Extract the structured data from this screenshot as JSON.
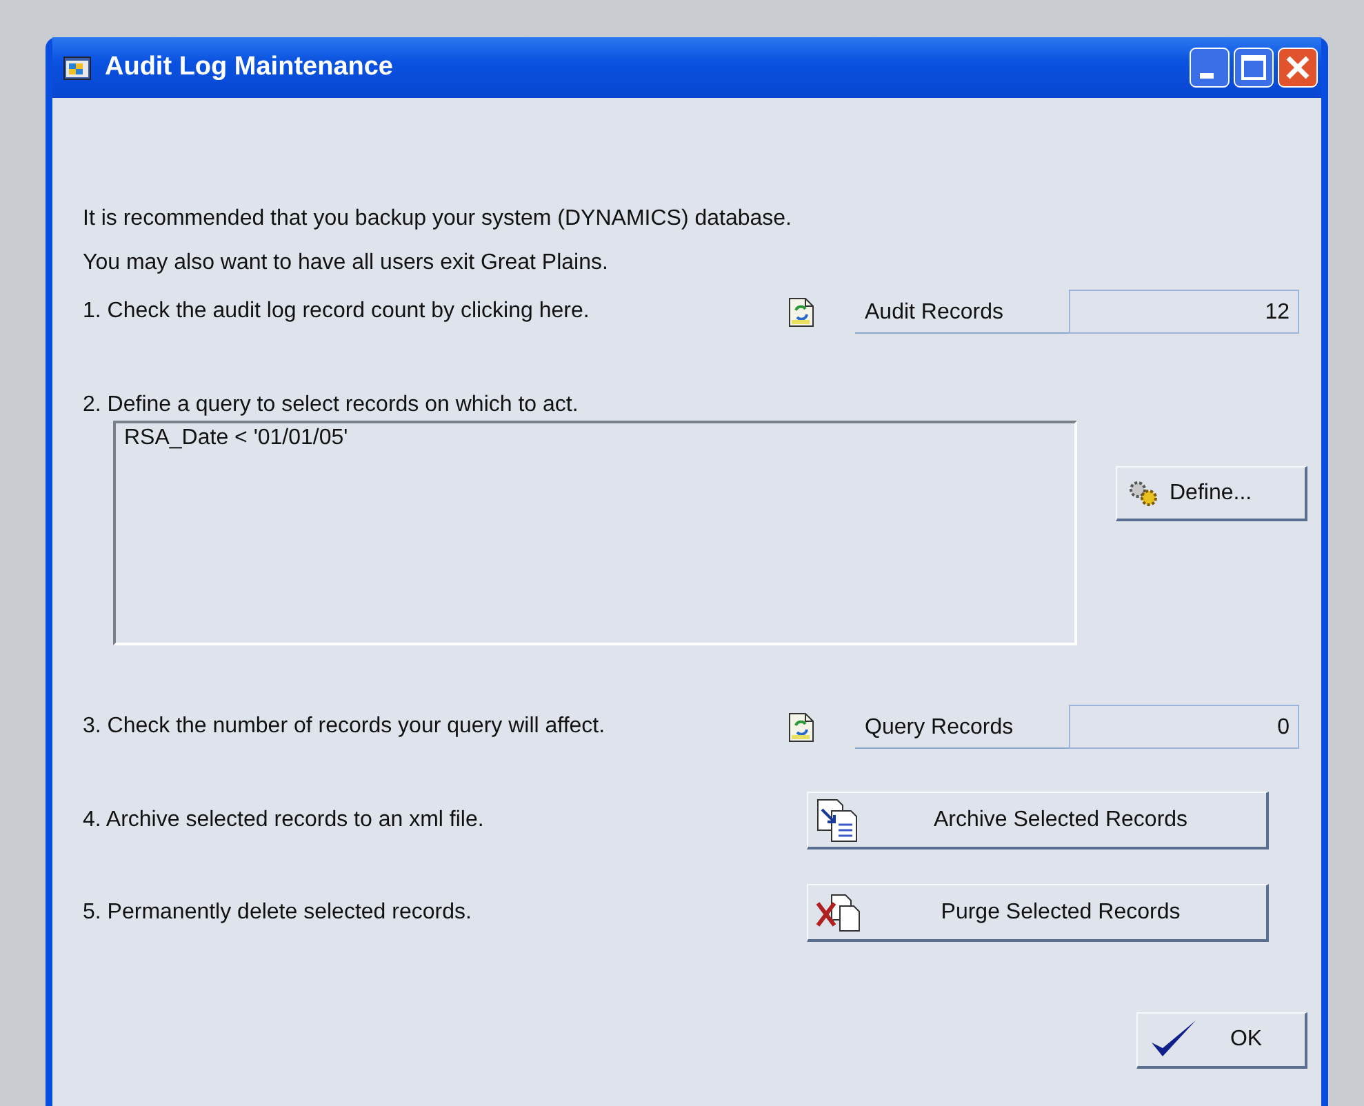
{
  "window": {
    "title": "Audit Log Maintenance"
  },
  "intro": [
    "It is recommended that you backup your system (DYNAMICS) database.",
    "You may also want to have all users exit Great Plains."
  ],
  "steps": [
    {
      "kind": "count",
      "label": "1. Check the audit log record count by clicking here.",
      "field_label": "Audit Records",
      "value": "12"
    },
    {
      "kind": "query",
      "label": "2. Define a query to select records on which to act.",
      "query": "RSA_Date < '01/01/05'",
      "button": "Define..."
    },
    {
      "kind": "count",
      "label": "3. Check the number of records your query will affect.",
      "field_label": "Query Records",
      "value": "0"
    },
    {
      "kind": "archive",
      "label": "4. Archive selected records to an xml file.",
      "button": "Archive Selected Records"
    },
    {
      "kind": "purge",
      "label": "5. Permanently delete selected records.",
      "button": "Purge Selected Records"
    }
  ],
  "ok_button": "OK"
}
